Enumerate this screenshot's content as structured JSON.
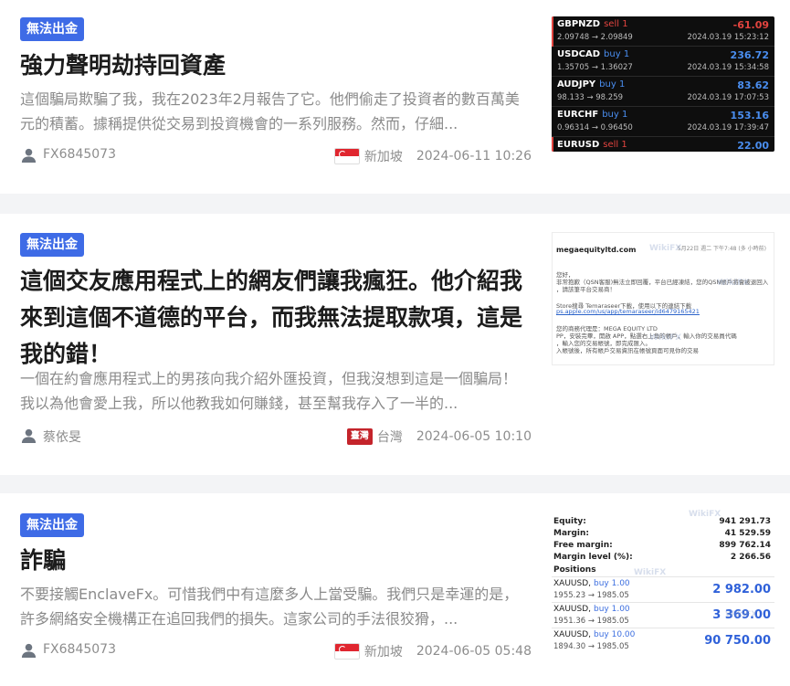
{
  "articles": [
    {
      "badge": "無法出金",
      "title": "強力聲明劫持回資產",
      "excerpt": "這個騙局欺騙了我，我在2023年2月報告了它。他們偷走了投資者的數百萬美元的積蓄。據稱提供從交易到投資機會的一系列服務。然而，仔細...",
      "author": "FX6845073",
      "region": "新加坡",
      "date": "2024-06-11 10:26",
      "thumb": {
        "trades": [
          {
            "symbol": "GBPNZD",
            "dir": "sell",
            "lots": "1",
            "prices": "2.09748 → 2.09849",
            "pl": "-61.09",
            "time": "2024.03.19 15:23:12"
          },
          {
            "symbol": "USDCAD",
            "dir": "buy",
            "lots": "1",
            "prices": "1.35705 → 1.36027",
            "pl": "236.72",
            "time": "2024.03.19 15:34:58"
          },
          {
            "symbol": "AUDJPY",
            "dir": "buy",
            "lots": "1",
            "prices": "98.133 → 98.259",
            "pl": "83.62",
            "time": "2024.03.19 17:07:53"
          },
          {
            "symbol": "EURCHF",
            "dir": "buy",
            "lots": "1",
            "prices": "0.96314 → 0.96450",
            "pl": "153.16",
            "time": "2024.03.19 17:39:47"
          },
          {
            "symbol": "EURUSD",
            "dir": "sell",
            "lots": "1",
            "prices": "",
            "pl": "22.00",
            "time": ""
          }
        ]
      }
    },
    {
      "badge": "無法出金",
      "title": "這個交友應用程式上的網友們讓我瘋狂。他介紹我來到這個不道德的平台，而我無法提取款項，這是我的錯！",
      "excerpt": "一個在約會應用程式上的男孩向我介紹外匯投資，但我沒想到這是一個騙局！我以為他會愛上我，所以他教我如何賺錢，甚至幫我存入了一半的...",
      "author": "蔡依旻",
      "region": "台灣",
      "region_flag_text": "臺灣",
      "date": "2024-06-05 10:10",
      "thumb": {
        "sender": "megaequityltd.com",
        "timestamp": "5月22日 週二 下午7:48 (多 小時前)",
        "lines": [
          "您好，",
          "非常抱歉（QSN客服)無法立即回覆，平台已經凍結，您的QSN帳戶將會被退回入",
          "，請該筆平台交易商！",
          "Store搜尋 Temaraseer下載，使用以下的連結下載",
          "ps.apple.com/us/app/temaraseer/id6479165421",
          "您的商務代理是：MEGA EQUITY LTD",
          "PP，安裝完畢，開啟 APP，點選右上角的帳戶，輸入你的交易員代碼",
          "，輸入您的交易帳號，即完成匯入。",
          "入帳號後，所有帳戶交易資訊在帳號頁面可見你的交易"
        ]
      }
    },
    {
      "badge": "無法出金",
      "title": "詐騙",
      "excerpt": "不要接觸EnclaveFx。可惜我們中有這麼多人上當受騙。我們只是幸運的是，許多網絡安全機構正在追回我們的損失。這家公司的手法很狡猾，...",
      "author": "FX6845073",
      "region": "新加坡",
      "date": "2024-06-05 05:48",
      "thumb": {
        "account": [
          {
            "label": "Equity:",
            "value": "941 291.73"
          },
          {
            "label": "Margin:",
            "value": "41 529.59"
          },
          {
            "label": "Free margin:",
            "value": "899 762.14"
          },
          {
            "label": "Margin level (%):",
            "value": "2 266.56"
          }
        ],
        "positions_label": "Positions",
        "positions": [
          {
            "symbol": "XAUUSD,",
            "dir": "buy 1.00",
            "range": "1955.23 → 1985.05",
            "profit": "2 982.00"
          },
          {
            "symbol": "XAUUSD,",
            "dir": "buy 1.00",
            "range": "1951.36 → 1985.05",
            "profit": "3 369.00"
          },
          {
            "symbol": "XAUUSD,",
            "dir": "buy 10.00",
            "range": "1894.30 → 1985.05",
            "profit": "90 750.00"
          }
        ]
      }
    }
  ],
  "watermark": "WikiFX",
  "colors": {
    "badge": "#3e6be6",
    "link": "#2a62c9",
    "sell": "#e2443f",
    "buy": "#4a8ef0"
  }
}
